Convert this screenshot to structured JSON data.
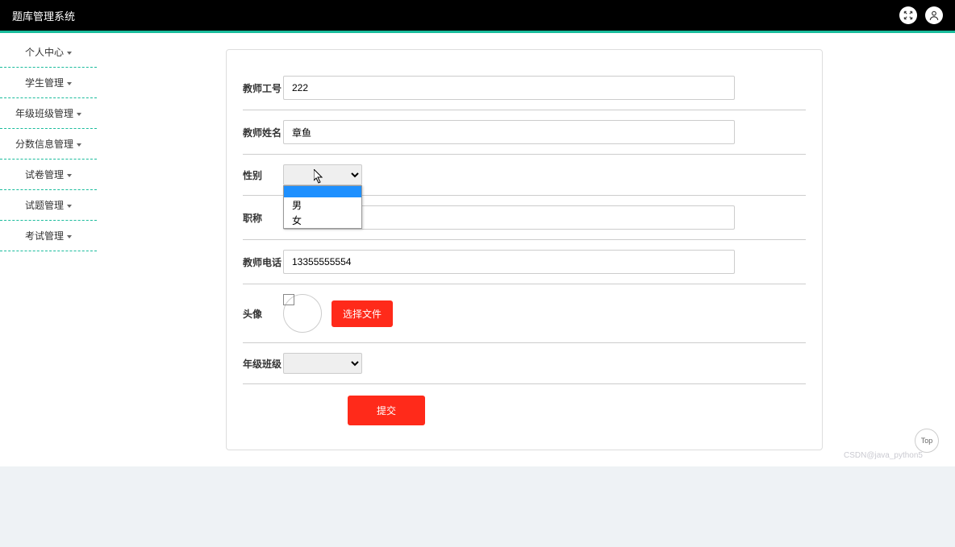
{
  "app_title": "题库管理系统",
  "sidebar": {
    "items": [
      {
        "label": "个人中心"
      },
      {
        "label": "学生管理"
      },
      {
        "label": "年级班级管理"
      },
      {
        "label": "分数信息管理"
      },
      {
        "label": "试卷管理"
      },
      {
        "label": "试题管理"
      },
      {
        "label": "考试管理"
      }
    ]
  },
  "form": {
    "teacher_id_label": "教师工号",
    "teacher_id_value": "222",
    "teacher_name_label": "教师姓名",
    "teacher_name_value": "章鱼",
    "gender_label": "性别",
    "gender_value": "",
    "gender_options": {
      "blank": "",
      "male": "男",
      "female": "女"
    },
    "title_label": "职称",
    "title_value": "",
    "phone_label": "教师电话",
    "phone_value": "13355555554",
    "avatar_label": "头像",
    "upload_btn": "选择文件",
    "class_label": "年级班级",
    "class_value": "",
    "submit_btn": "提交"
  },
  "top_btn": "Top",
  "watermark": "CSDN@java_python5"
}
